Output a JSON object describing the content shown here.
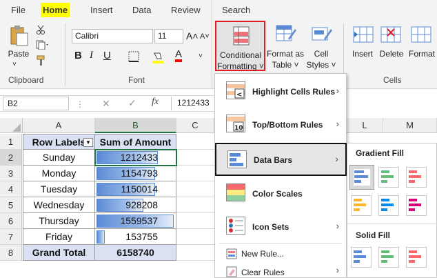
{
  "ribbon": {
    "tabs": [
      "File",
      "Home",
      "Insert",
      "Data",
      "Review",
      "Search"
    ],
    "clipboard": {
      "paste": "Paste",
      "label": "Clipboard"
    },
    "font": {
      "name": "Calibri",
      "size": "11",
      "label": "Font"
    },
    "styles": {
      "conditional_formatting": [
        "Conditional",
        "Formatting ˅"
      ],
      "format_as_table": [
        "Format as",
        "Table ˅"
      ],
      "cell_styles": [
        "Cell",
        "Styles ˅"
      ]
    },
    "cells": {
      "insert": "Insert",
      "delete": "Delete",
      "format": "Format",
      "label": "Cells"
    }
  },
  "formula_bar": {
    "name_box": "B2",
    "fx": "fx",
    "value": "1212433"
  },
  "columns": [
    "A",
    "B",
    "C"
  ],
  "right_columns": [
    "L",
    "M"
  ],
  "rows": [
    "1",
    "2",
    "3",
    "4",
    "5",
    "6",
    "7",
    "8"
  ],
  "pivot": {
    "header_a": "Row Labels",
    "header_b": "Sum of Amount",
    "items": [
      {
        "label": "Sunday",
        "value": "1212433",
        "bar": 0.78
      },
      {
        "label": "Monday",
        "value": "1154793",
        "bar": 0.74
      },
      {
        "label": "Tuesday",
        "value": "1150014",
        "bar": 0.74
      },
      {
        "label": "Wednesday",
        "value": "928208",
        "bar": 0.6
      },
      {
        "label": "Thursday",
        "value": "1559537",
        "bar": 1.0
      },
      {
        "label": "Friday",
        "value": "153755",
        "bar": 0.1
      }
    ],
    "total_label": "Grand Total",
    "total_value": "6158740"
  },
  "menu": {
    "items": [
      {
        "label": "Highlight Cells Rules",
        "arrow": "›"
      },
      {
        "label": "Top/Bottom Rules",
        "arrow": "›"
      },
      {
        "label": "Data Bars",
        "arrow": "›"
      },
      {
        "label": "Color Scales",
        "arrow": "›"
      },
      {
        "label": "Icon Sets",
        "arrow": "›"
      }
    ],
    "new_rule": "New Rule...",
    "clear_rules": "Clear Rules"
  },
  "submenu": {
    "gradient_fill": "Gradient Fill",
    "solid_fill": "Solid Fill"
  },
  "colors": {
    "blue": "#5b8bd5",
    "green": "#63be7b",
    "red": "#f8696b",
    "orange": "#ffb628",
    "light_blue": "#008aef",
    "purple": "#d6007b",
    "highlight_red": "#e31b23"
  }
}
